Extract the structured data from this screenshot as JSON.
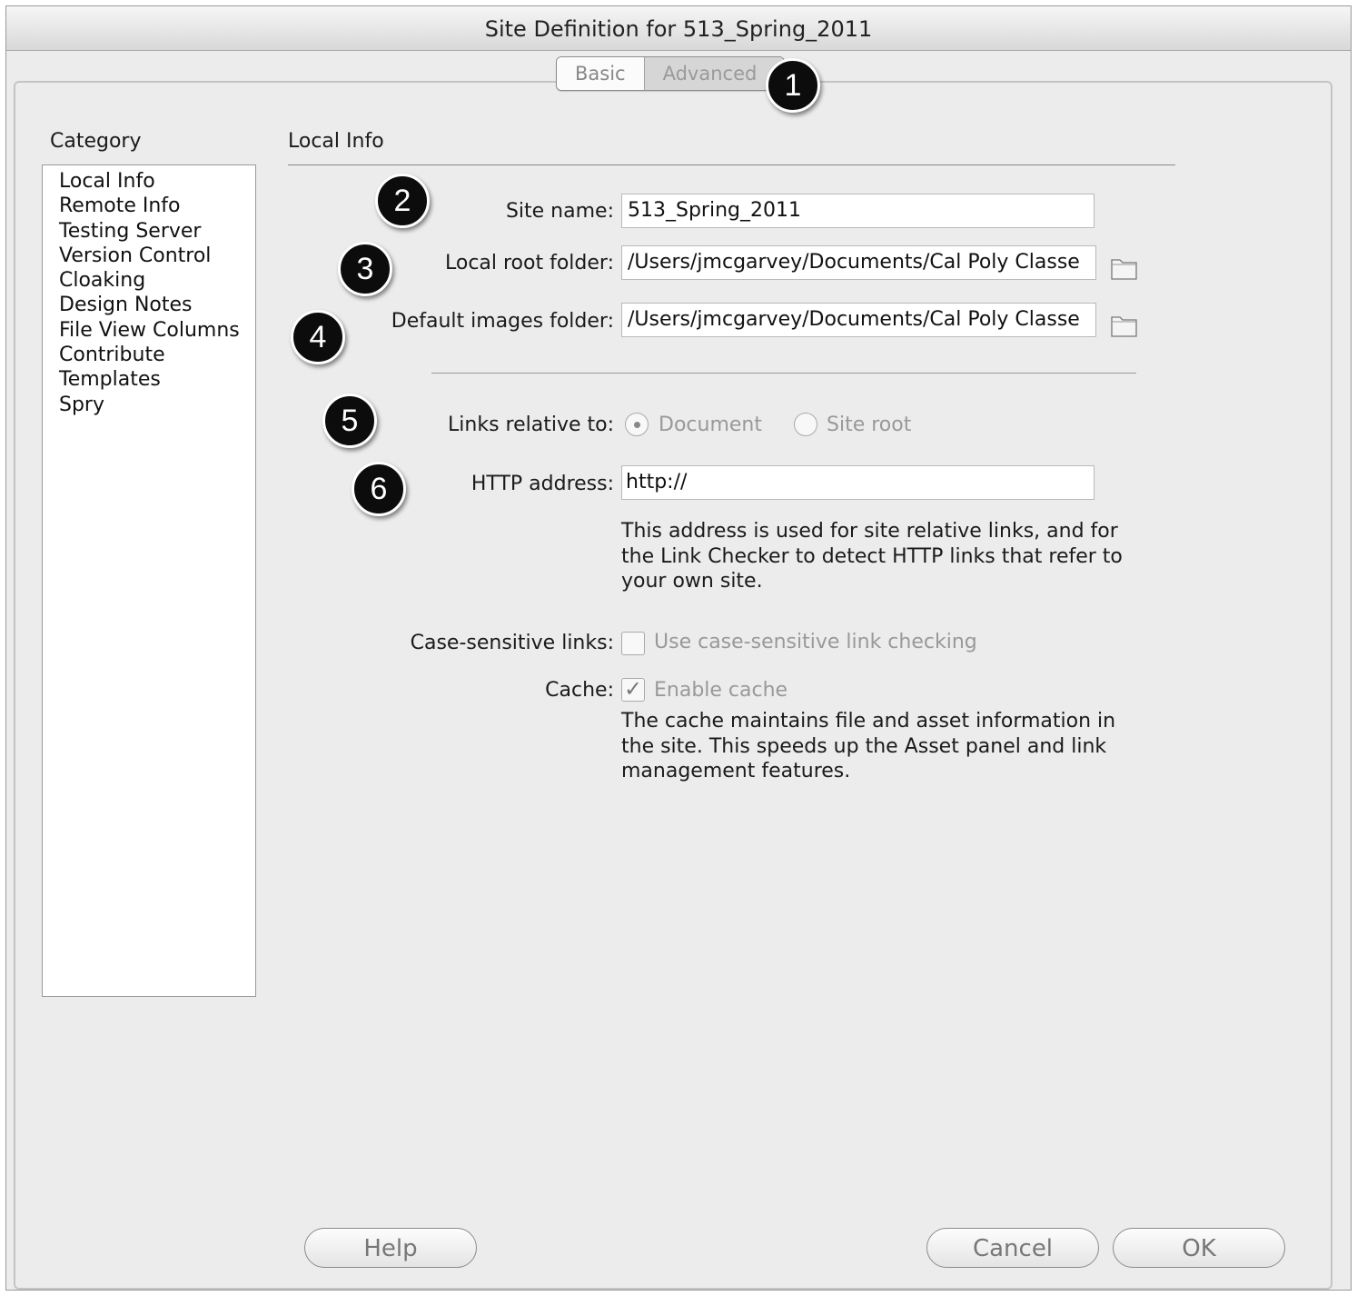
{
  "window": {
    "title": "Site Definition for 513_Spring_2011"
  },
  "tabs": {
    "basic": "Basic",
    "advanced": "Advanced"
  },
  "badges": [
    "1",
    "2",
    "3",
    "4",
    "5",
    "6"
  ],
  "category": {
    "heading": "Category",
    "items": [
      "Local Info",
      "Remote Info",
      "Testing Server",
      "Version Control",
      "Cloaking",
      "Design Notes",
      "File View Columns",
      "Contribute",
      "Templates",
      "Spry"
    ]
  },
  "local_info": {
    "heading": "Local Info",
    "site_name_label": "Site name:",
    "site_name_value": "513_Spring_2011",
    "local_root_label": "Local root folder:",
    "local_root_value": "/Users/jmcgarvey/Documents/Cal Poly Classe",
    "images_folder_label": "Default images folder:",
    "images_folder_value": "/Users/jmcgarvey/Documents/Cal Poly Classe",
    "links_relative_label": "Links relative to:",
    "links_option_document": "Document",
    "links_option_site_root": "Site root",
    "links_selected": "Document",
    "http_label": "HTTP address:",
    "http_value": "http://",
    "http_help_line1": "This address is used for site relative links, and for",
    "http_help_line2": "the Link Checker to detect HTTP links that refer to",
    "http_help_line3": "your own site.",
    "case_label": "Case-sensitive links:",
    "case_checkbox": "Use case-sensitive link checking",
    "case_checked": false,
    "cache_label": "Cache:",
    "cache_checkbox": "Enable cache",
    "cache_checked": true,
    "cache_help_line1": "The cache maintains file and asset information in",
    "cache_help_line2": "the site.  This speeds up the Asset panel and link",
    "cache_help_line3": "management features."
  },
  "buttons": {
    "help": "Help",
    "cancel": "Cancel",
    "ok": "OK"
  },
  "icons": {
    "folder": "folder-icon",
    "checkmark": "✓"
  }
}
